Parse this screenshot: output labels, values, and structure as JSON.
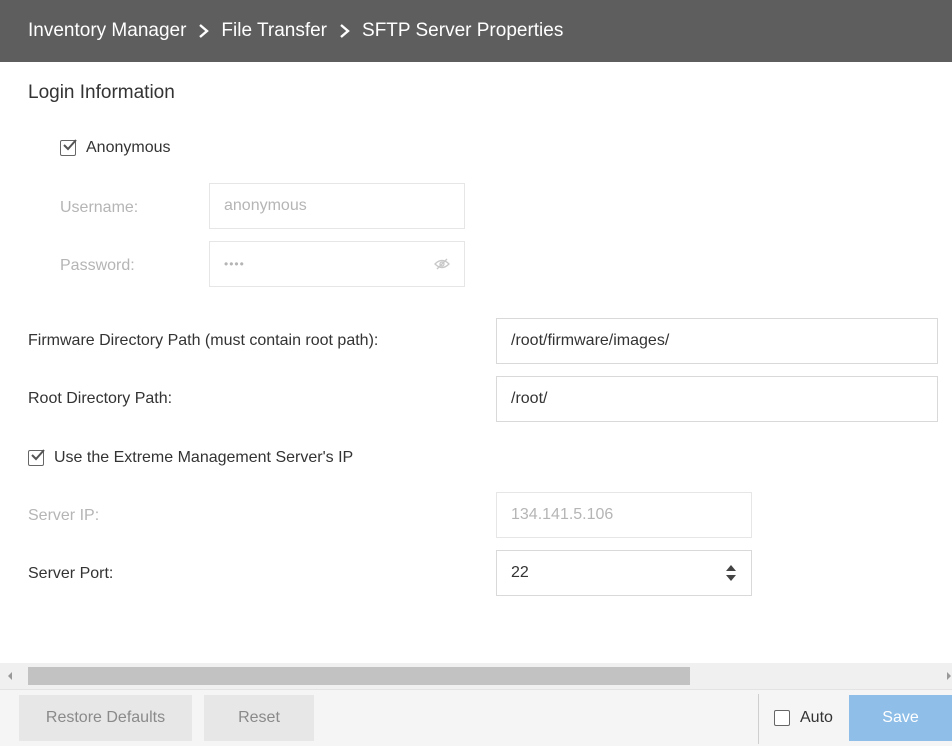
{
  "breadcrumb": [
    "Inventory Manager",
    "File Transfer",
    "SFTP Server Properties"
  ],
  "login": {
    "section_title": "Login Information",
    "anonymous_label": "Anonymous",
    "anonymous_checked": true,
    "username_label": "Username:",
    "username_value": "anonymous",
    "password_label": "Password:",
    "password_value": "••••"
  },
  "paths": {
    "firmware_label": "Firmware Directory Path (must contain root path):",
    "firmware_value": "/root/firmware/images/",
    "root_label": "Root Directory Path:",
    "root_value": "/root/"
  },
  "server": {
    "use_ems_ip_label": "Use the Extreme Management Server's IP",
    "use_ems_ip_checked": true,
    "ip_label": "Server IP:",
    "ip_value": "134.141.5.106",
    "port_label": "Server Port:",
    "port_value": "22"
  },
  "footer": {
    "restore_defaults": "Restore Defaults",
    "reset": "Reset",
    "auto_label": "Auto",
    "auto_checked": false,
    "save": "Save"
  },
  "colors": {
    "header_bg": "#5e5e5e",
    "save_bg": "#8fbfe8",
    "disabled_text": "#b5b5b5"
  },
  "icons": {
    "breadcrumb_separator": "chevron-right-icon",
    "password_toggle": "eye-slash-icon",
    "port_spinner": "up-down-spinner-icon",
    "checkbox": "checkmark-icon"
  }
}
